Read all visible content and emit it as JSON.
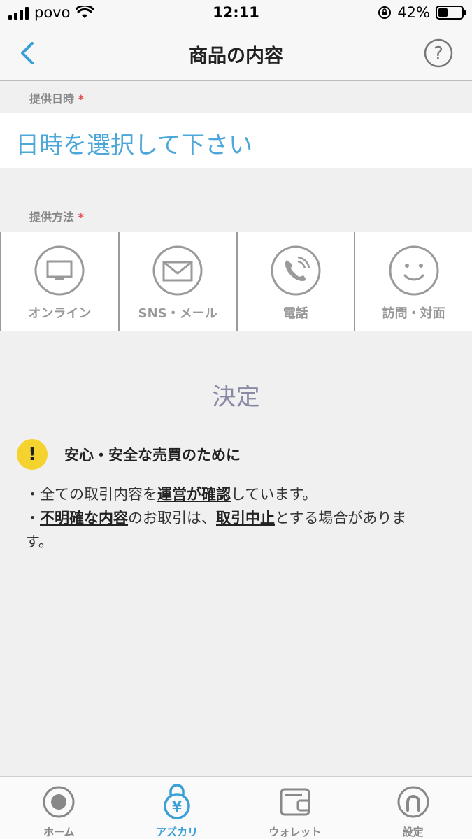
{
  "status_bar": {
    "carrier": "povo",
    "time": "12:11",
    "battery": "42%",
    "battery_level": 0.42
  },
  "nav": {
    "title": "商品の内容",
    "back_icon": "chevron-left-icon",
    "help_icon": "question-circle-icon"
  },
  "form": {
    "date_label": "提供日時",
    "date_required": "*",
    "date_placeholder": "日時を選択して下さい",
    "method_label": "提供方法",
    "method_required": "*",
    "methods": [
      {
        "label": "オンライン",
        "icon": "monitor-icon"
      },
      {
        "label": "SNS・メール",
        "icon": "mail-icon"
      },
      {
        "label": "電話",
        "icon": "phone-icon"
      },
      {
        "label": "訪問・対面",
        "icon": "smile-icon"
      }
    ],
    "submit_label": "決定"
  },
  "notice": {
    "icon": "warning-icon",
    "title": "安心・安全な売買のために",
    "line1_pre": "・全ての取引内容を",
    "line1_em": "運営が確認",
    "line1_post": "しています。",
    "line2_pre": "・",
    "line2_em1": "不明確な内容",
    "line2_mid": "のお取引は、",
    "line2_em2": "取引中止",
    "line2_post": "とする場合がありま",
    "line3": "す。"
  },
  "tabs": [
    {
      "label": "ホーム",
      "icon": "home-icon"
    },
    {
      "label": "アズカリ",
      "icon": "yen-lock-icon",
      "active": true
    },
    {
      "label": "ウォレット",
      "icon": "wallet-icon"
    },
    {
      "label": "設定",
      "icon": "settings-icon"
    }
  ],
  "colors": {
    "accent": "#3aa0d8",
    "placeholder": "#4da7d9",
    "warning": "#f4d32e",
    "required": "#e05050"
  }
}
